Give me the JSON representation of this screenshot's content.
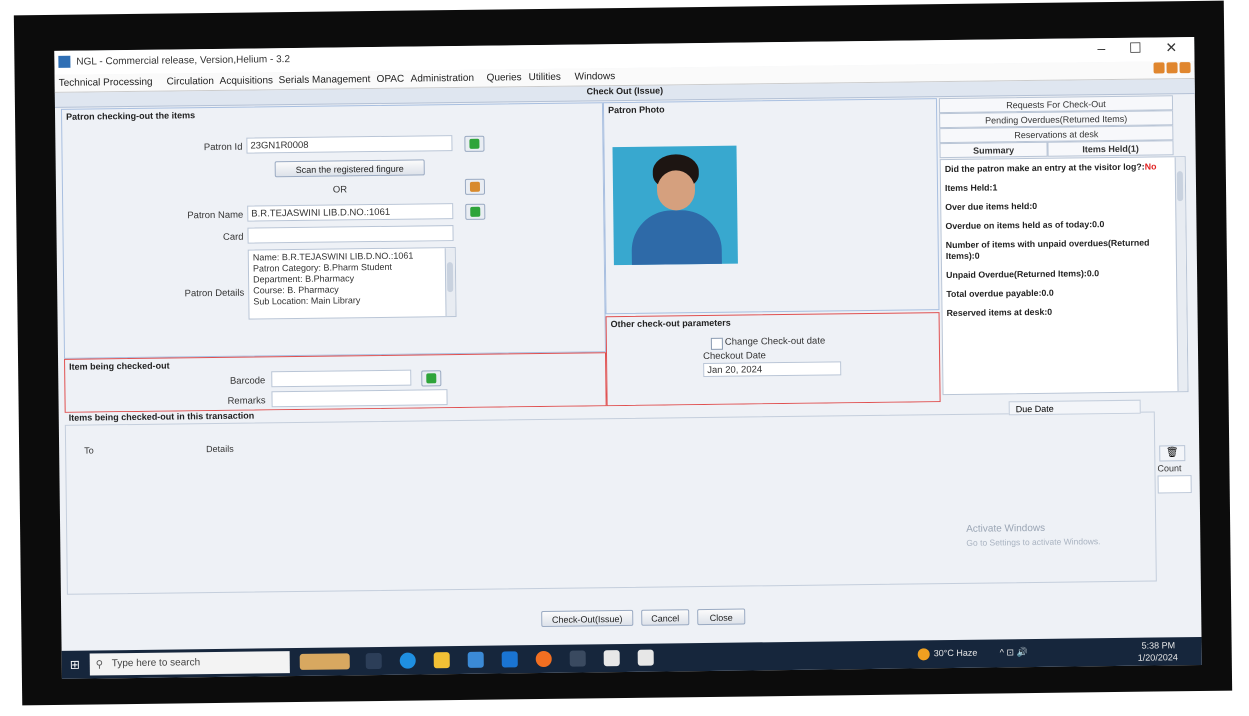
{
  "window": {
    "title": "NGL - Commercial release, Version,Helium - 3.2",
    "controls": [
      "–",
      "☐",
      "✕"
    ]
  },
  "menu": [
    "Technical Processing",
    "Circulation",
    "Acquisitions",
    "Serials Management",
    "OPAC",
    "Administration",
    "Queries",
    "Utilities",
    "Windows"
  ],
  "form_title": "Check Out (Issue)",
  "patron": {
    "section_title": "Patron checking-out the items",
    "id_label": "Patron Id",
    "id_value": "23GN1R0008",
    "scan_button": "Scan the registered fingure",
    "or_text": "OR",
    "name_label": "Patron Name",
    "name_value": "B.R.TEJASWINI LIB.D.NO.:1061",
    "card_label": "Card",
    "card_value": "",
    "details_label": "Patron Details",
    "details_lines": [
      "Name: B.R.TEJASWINI LIB.D.NO.:1061",
      "Patron Category: B.Pharm Student",
      "Department: B.Pharmacy",
      "Course: B. Pharmacy",
      "Sub Location: Main Library"
    ]
  },
  "photo": {
    "section_title": "Patron Photo"
  },
  "item": {
    "section_title": "Item being checked-out",
    "barcode_label": "Barcode",
    "barcode_value": "",
    "remarks_label": "Remarks",
    "remarks_value": ""
  },
  "params": {
    "section_title": "Other check-out parameters",
    "change_date_label": "Change Check-out date",
    "change_date_checked": false,
    "checkout_date_label": "Checkout Date",
    "checkout_date_value": "Jan 20, 2024"
  },
  "right_tabs": [
    "Requests For Check-Out",
    "Pending Overdues(Returned Items)",
    "Reservations at desk"
  ],
  "summary_tabs": [
    "Summary",
    "Items Held(1)"
  ],
  "summary": {
    "visitor_q": "Did the patron make an entry at the visitor log?:",
    "visitor_a": "No",
    "items_held": "Items Held:1",
    "overdue_items": "Over due items held:0",
    "overdue_today": "Overdue on items held as of today:0.0",
    "unpaid_count": "Number of items with unpaid overdues(Returned Items):0",
    "unpaid_amount": "Unpaid Overdue(Returned Items):0.0",
    "total_overdue": "Total overdue payable:0.0",
    "reserved": "Reserved items at desk:0"
  },
  "transaction": {
    "section_title": "Items being checked-out in this transaction",
    "columns": [
      "To",
      "Details"
    ],
    "due_date_header": "Due Date",
    "count_label": "Count",
    "count_value": ""
  },
  "watermark": [
    "Activate Windows",
    "Go to Settings to activate Windows."
  ],
  "buttons": {
    "checkout": "Check-Out(Issue)",
    "cancel": "Cancel",
    "close": "Close"
  },
  "taskbar": {
    "search_placeholder": "Type here to search",
    "weather": "30°C  Haze",
    "time": "5:38 PM",
    "date": "1/20/2024"
  }
}
